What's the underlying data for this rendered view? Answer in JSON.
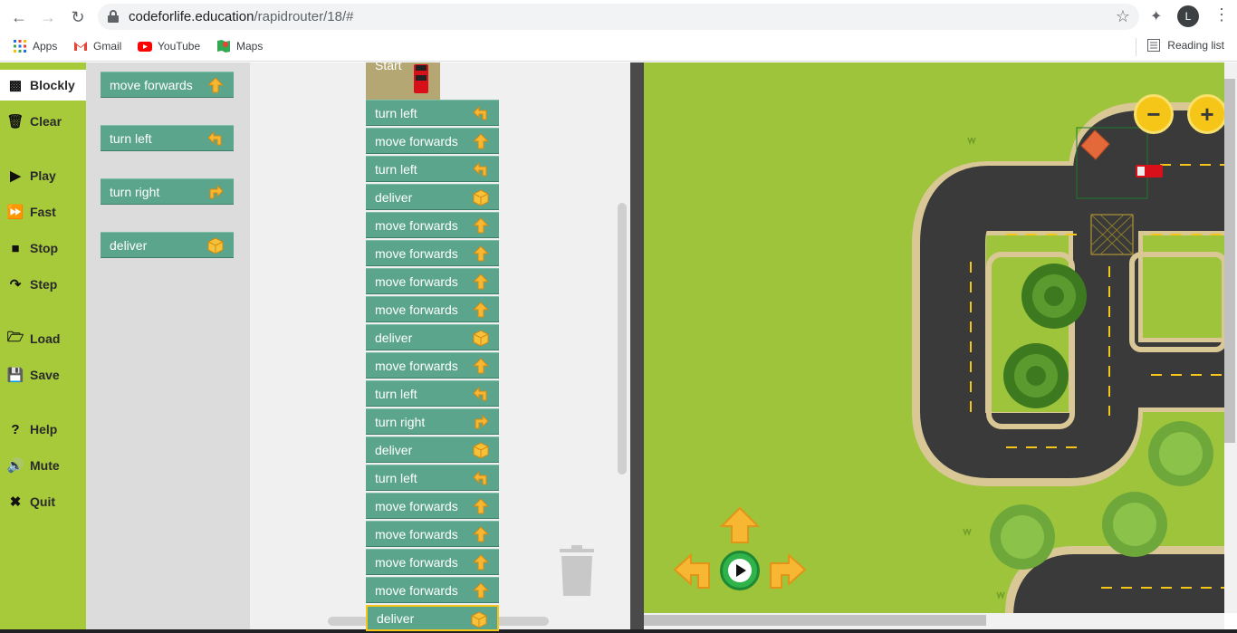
{
  "browser": {
    "url_domain": "codeforlife.education",
    "url_path": "/rapidrouter/18/#",
    "avatar_initial": "L",
    "bookmarks": [
      "Apps",
      "Gmail",
      "YouTube",
      "Maps"
    ],
    "reading_list": "Reading list"
  },
  "sidebar": {
    "items": [
      {
        "label": "Blockly",
        "icon": "blockly-icon"
      },
      {
        "label": "Clear",
        "icon": "trash-icon"
      },
      {
        "label": "Play",
        "icon": "play-icon"
      },
      {
        "label": "Fast",
        "icon": "fast-forward-icon"
      },
      {
        "label": "Stop",
        "icon": "stop-icon"
      },
      {
        "label": "Step",
        "icon": "step-icon"
      },
      {
        "label": "Load",
        "icon": "folder-icon"
      },
      {
        "label": "Save",
        "icon": "floppy-icon"
      },
      {
        "label": "Help",
        "icon": "question-icon"
      },
      {
        "label": "Mute",
        "icon": "speaker-icon"
      },
      {
        "label": "Quit",
        "icon": "close-icon"
      }
    ]
  },
  "toolbox": {
    "blocks": [
      {
        "label": "move forwards",
        "icon": "arrow-up-icon"
      },
      {
        "label": "turn left",
        "icon": "arrow-left-icon"
      },
      {
        "label": "turn right",
        "icon": "arrow-right-icon"
      },
      {
        "label": "deliver",
        "icon": "box-icon"
      }
    ]
  },
  "workspace": {
    "start_label": "Start",
    "program": [
      {
        "label": "turn left",
        "icon": "arrow-left-icon"
      },
      {
        "label": "move forwards",
        "icon": "arrow-up-icon"
      },
      {
        "label": "turn left",
        "icon": "arrow-left-icon"
      },
      {
        "label": "deliver",
        "icon": "box-icon"
      },
      {
        "label": "move forwards",
        "icon": "arrow-up-icon"
      },
      {
        "label": "move forwards",
        "icon": "arrow-up-icon"
      },
      {
        "label": "move forwards",
        "icon": "arrow-up-icon"
      },
      {
        "label": "move forwards",
        "icon": "arrow-up-icon"
      },
      {
        "label": "deliver",
        "icon": "box-icon"
      },
      {
        "label": "move forwards",
        "icon": "arrow-up-icon"
      },
      {
        "label": "turn left",
        "icon": "arrow-left-icon"
      },
      {
        "label": "turn right",
        "icon": "arrow-right-icon"
      },
      {
        "label": "deliver",
        "icon": "box-icon"
      },
      {
        "label": "turn left",
        "icon": "arrow-left-icon"
      },
      {
        "label": "move forwards",
        "icon": "arrow-up-icon"
      },
      {
        "label": "move forwards",
        "icon": "arrow-up-icon"
      },
      {
        "label": "move forwards",
        "icon": "arrow-up-icon"
      },
      {
        "label": "move forwards",
        "icon": "arrow-up-icon"
      },
      {
        "label": "deliver",
        "icon": "box-icon"
      }
    ]
  },
  "map": {
    "zoom_out": "−",
    "zoom_in": "+",
    "controls": [
      "forward-arrow-icon",
      "left-arrow-icon",
      "play-icon",
      "right-arrow-icon"
    ]
  },
  "colors": {
    "sidebar": "#a7ca3a",
    "block": "#5ba58c",
    "grass": "#9dc43b",
    "road": "#3a3a3a",
    "arrow": "#f7b733"
  }
}
